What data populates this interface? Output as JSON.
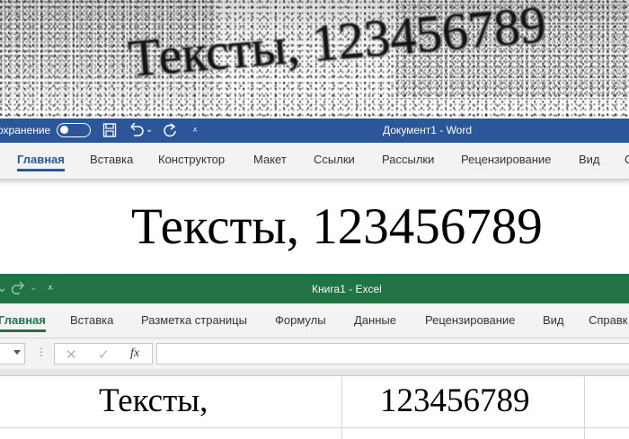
{
  "scan": {
    "text": "Тексты, 123456789"
  },
  "word": {
    "autosave_label": "охранение",
    "title": "Документ1  -  Word",
    "tabs": [
      "Главная",
      "Вставка",
      "Конструктор",
      "Макет",
      "Ссылки",
      "Рассылки",
      "Рецензирование",
      "Вид",
      "С"
    ],
    "active_tab": "Главная",
    "document_text": "Тексты, 123456789",
    "accent_color": "#2b579a"
  },
  "excel": {
    "title": "Книга1  -  Excel",
    "tabs": [
      "Главная",
      "Вставка",
      "Разметка страницы",
      "Формулы",
      "Данные",
      "Рецензирование",
      "Вид",
      "Справк"
    ],
    "active_tab": "Главная",
    "formula_bar": {
      "fx_label": "fx",
      "cancel_icon": "✕",
      "enter_icon": "✓"
    },
    "cells": {
      "a1": "Тексты,",
      "b1": "123456789"
    },
    "accent_color": "#217346"
  },
  "icons": [
    "autosave-toggle",
    "save-icon",
    "undo-icon",
    "redo-icon",
    "customize-qat-icon"
  ]
}
